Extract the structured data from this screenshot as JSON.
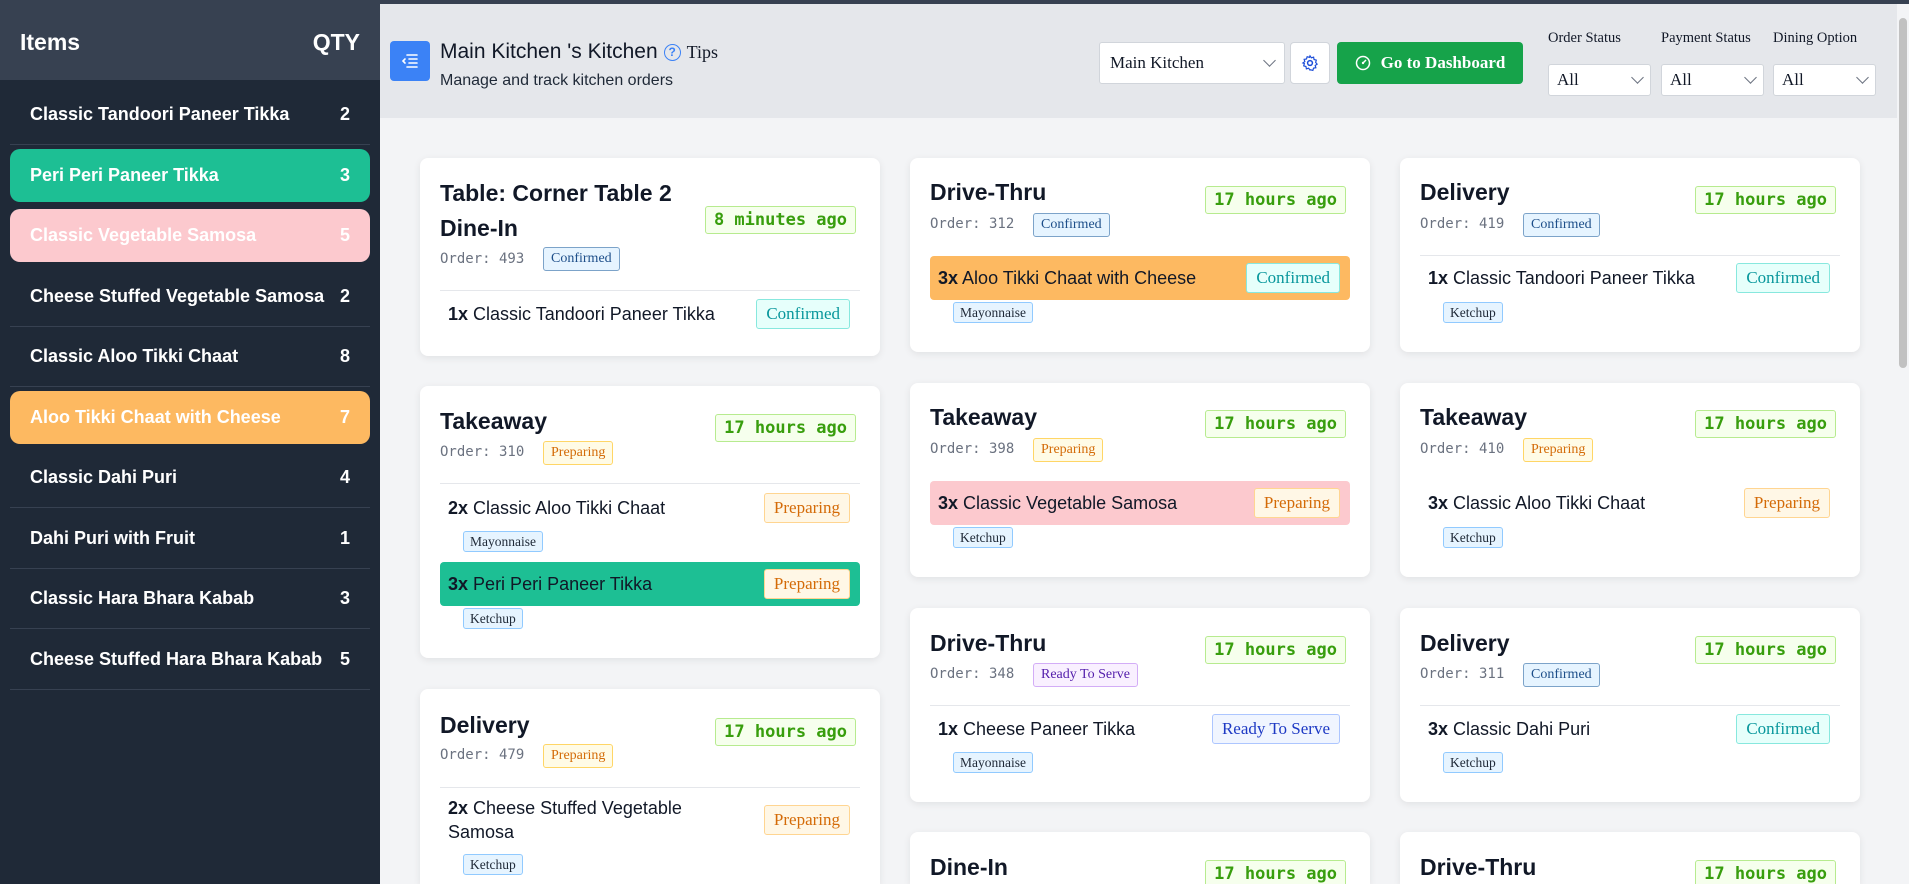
{
  "sidebar": {
    "header_items": "Items",
    "header_qty": "QTY",
    "items": [
      {
        "label": "Classic Tandoori Paneer Tikka",
        "qty": "2"
      },
      {
        "label": "Peri Peri Paneer Tikka",
        "qty": "3"
      },
      {
        "label": "Classic Vegetable Samosa",
        "qty": "5"
      },
      {
        "label": "Cheese Stuffed Vegetable Samosa",
        "qty": "2"
      },
      {
        "label": "Classic Aloo Tikki Chaat",
        "qty": "8"
      },
      {
        "label": "Aloo Tikki Chaat with Cheese",
        "qty": "7"
      },
      {
        "label": "Classic Dahi Puri",
        "qty": "4"
      },
      {
        "label": "Dahi Puri with Fruit",
        "qty": "1"
      },
      {
        "label": "Classic Hara Bhara Kabab",
        "qty": "3"
      },
      {
        "label": "Cheese Stuffed Hara Bhara Kabab",
        "qty": "5"
      }
    ]
  },
  "header": {
    "title": "Main Kitchen 's Kitchen",
    "help_icon": "?",
    "tips": "Tips",
    "subtitle": "Manage and track kitchen orders",
    "kitchen_select": "Main Kitchen",
    "dashboard_button": "Go to Dashboard",
    "filters": {
      "order_status_label": "Order Status",
      "order_status_value": "All",
      "payment_status_label": "Payment Status",
      "payment_status_value": "All",
      "dining_option_label": "Dining Option",
      "dining_option_value": "All"
    }
  },
  "orders": {
    "c1": {
      "title1": "Table: Corner Table 2",
      "title2": "Dine-In",
      "time": "8 minutes ago",
      "order": "Order: 493",
      "status": "Confirmed",
      "lines": [
        {
          "qty": "1x",
          "name": "Classic Tandoori Paneer Tikka",
          "status": "Confirmed"
        }
      ]
    },
    "c2": {
      "title": "Takeaway",
      "time": "17 hours ago",
      "order": "Order: 310",
      "status": "Preparing",
      "lines": [
        {
          "qty": "2x",
          "name": "Classic Aloo Tikki Chaat",
          "status": "Preparing",
          "modifier": "Mayonnaise"
        },
        {
          "qty": "3x",
          "name": "Peri Peri Paneer Tikka",
          "status": "Preparing",
          "modifier": "Ketchup"
        }
      ]
    },
    "c3": {
      "title": "Delivery",
      "time": "17 hours ago",
      "order": "Order: 479",
      "status": "Preparing",
      "lines": [
        {
          "qty": "2x",
          "name": "Cheese Stuffed Vegetable Samosa",
          "status": "Preparing",
          "modifier": "Ketchup"
        }
      ]
    },
    "c4": {
      "title": "Drive-Thru",
      "time": "17 hours ago",
      "order": "Order: 312",
      "status": "Confirmed",
      "lines": [
        {
          "qty": "3x",
          "name": "Aloo Tikki Chaat with Cheese",
          "status": "Confirmed",
          "modifier": "Mayonnaise"
        }
      ]
    },
    "c5": {
      "title": "Takeaway",
      "time": "17 hours ago",
      "order": "Order: 398",
      "status": "Preparing",
      "lines": [
        {
          "qty": "3x",
          "name": "Classic Vegetable Samosa",
          "status": "Preparing",
          "modifier": "Ketchup"
        }
      ]
    },
    "c6": {
      "title": "Drive-Thru",
      "time": "17 hours ago",
      "order": "Order: 348",
      "status": "Ready To Serve",
      "lines": [
        {
          "qty": "1x",
          "name": "Cheese Paneer Tikka",
          "status": "Ready To Serve",
          "modifier": "Mayonnaise"
        }
      ]
    },
    "c7": {
      "title": "Dine-In",
      "time": "17 hours ago"
    },
    "c8": {
      "title": "Delivery",
      "time": "17 hours ago",
      "order": "Order: 419",
      "status": "Confirmed",
      "lines": [
        {
          "qty": "1x",
          "name": "Classic Tandoori Paneer Tikka",
          "status": "Confirmed",
          "modifier": "Ketchup"
        }
      ]
    },
    "c9": {
      "title": "Takeaway",
      "time": "17 hours ago",
      "order": "Order: 410",
      "status": "Preparing",
      "lines": [
        {
          "qty": "3x",
          "name": "Classic Aloo Tikki Chaat",
          "status": "Preparing",
          "modifier": "Ketchup"
        }
      ]
    },
    "c10": {
      "title": "Delivery",
      "time": "17 hours ago",
      "order": "Order: 311",
      "status": "Confirmed",
      "lines": [
        {
          "qty": "3x",
          "name": "Classic Dahi Puri",
          "status": "Confirmed",
          "modifier": "Ketchup"
        }
      ]
    },
    "c11": {
      "title": "Drive-Thru",
      "time": "17 hours ago"
    }
  }
}
